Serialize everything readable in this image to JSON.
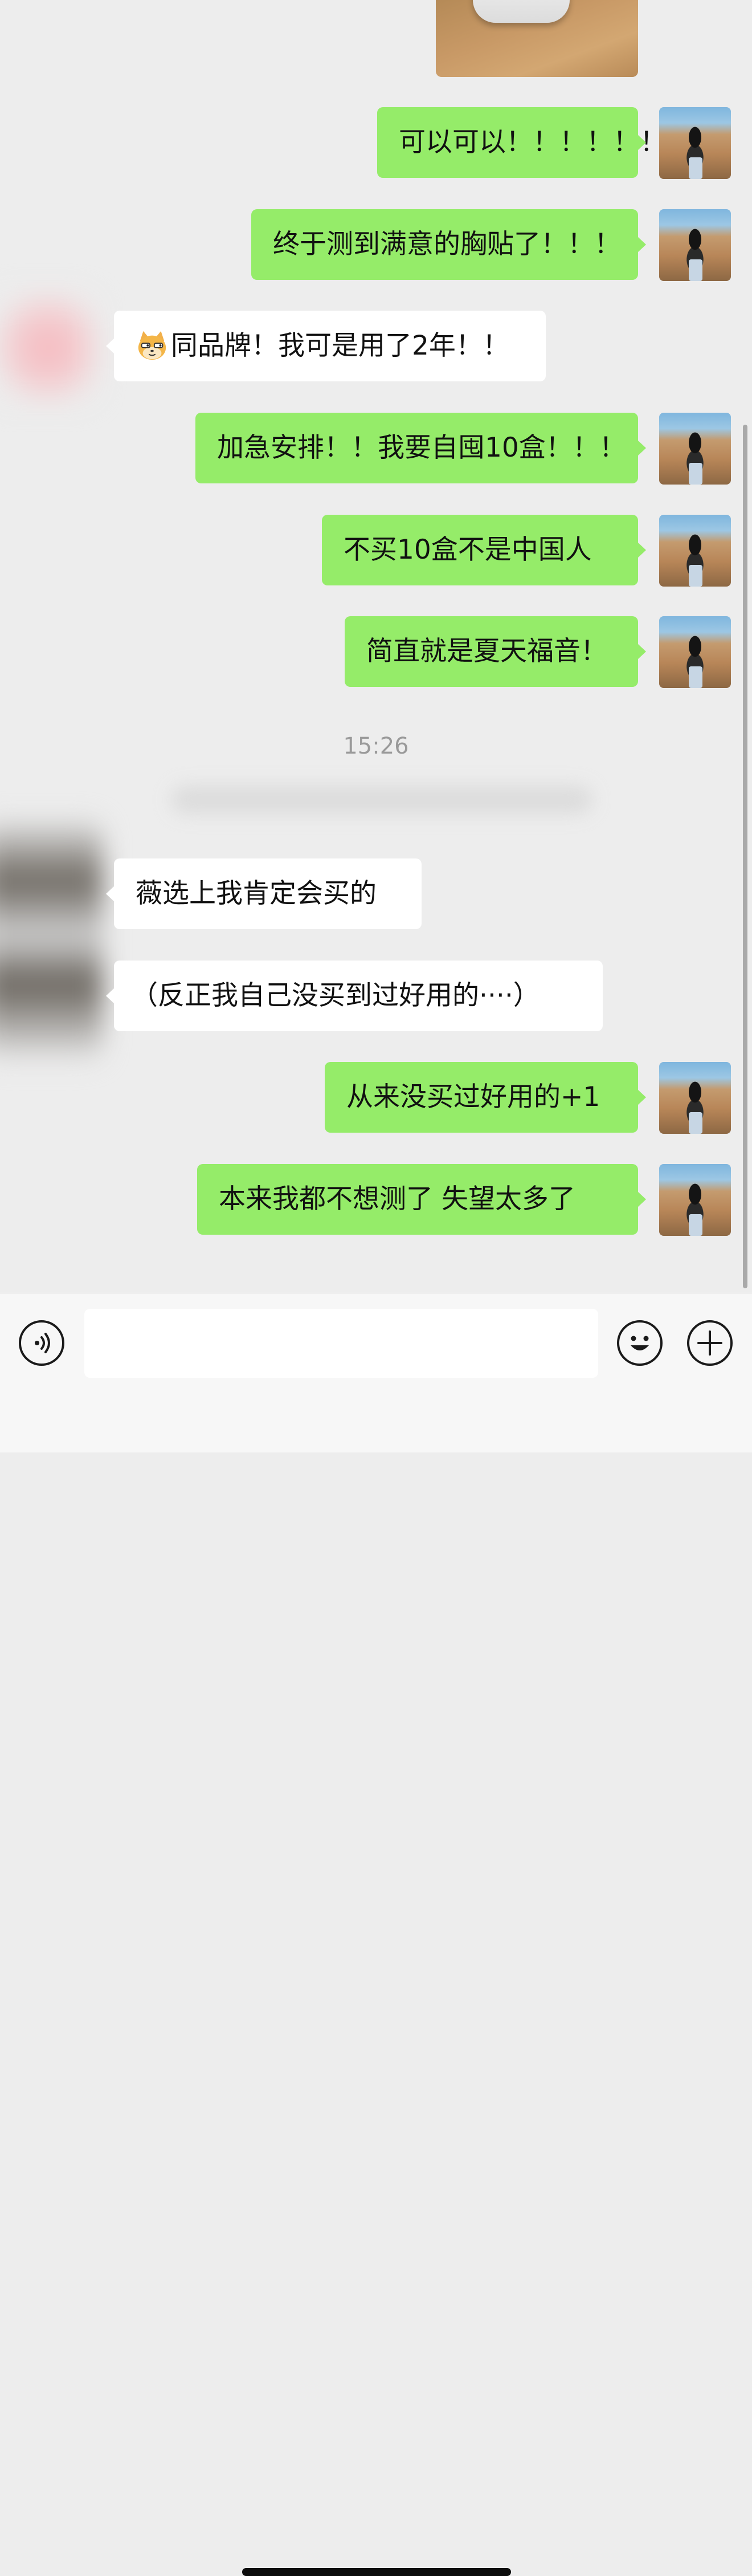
{
  "chat": {
    "messages": [
      {
        "from": "me",
        "text": "可以可以！！！！！！"
      },
      {
        "from": "me",
        "text": "终于测到满意的胸贴了！！！"
      },
      {
        "from": "them",
        "text": "同品牌！我可是用了2年！！",
        "emoji": "cat-emoji"
      },
      {
        "from": "me",
        "text": "加急安排！！我要自囤10盒！！！"
      },
      {
        "from": "me",
        "text": "不买10盒不是中国人"
      },
      {
        "from": "me",
        "text": "简直就是夏天福音！"
      },
      {
        "from": "them",
        "text": "薇选上我肯定会买的"
      },
      {
        "from": "them",
        "text": "（反正我自己没买到过好用的····）"
      },
      {
        "from": "me",
        "text": "从来没买过好用的+1"
      },
      {
        "from": "me",
        "text": "本来我都不想测了  失望太多了"
      }
    ],
    "timestamp": "15:26"
  },
  "input_bar": {
    "voice_icon": "voice-icon",
    "emoji_icon": "smiley-icon",
    "plus_icon": "plus-icon",
    "input_value": ""
  },
  "colors": {
    "background": "#ededed",
    "my_bubble": "#95ec69",
    "their_bubble": "#ffffff",
    "timestamp": "#9a9a9a"
  }
}
